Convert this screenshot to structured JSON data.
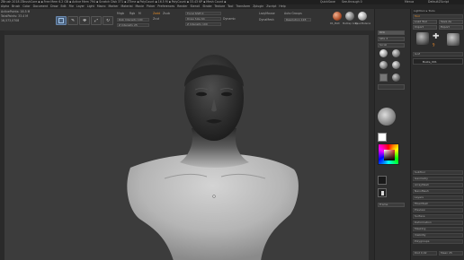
{
  "titlebar": {
    "left": "ZBrush 2018   ZBrushCore ▪  ▪ Free Mem 6.2 GB ▪ Active Mem 794 ▪ Scratch Disk 371 ▪ ZTime ▪ PolyCount ▪ 16.5 M ▪ PolyCount ▪ 33.43 KP ▪ Mesh Count ▪",
    "quicksave": "QuickSave",
    "see_through": "See-through 0",
    "menus": "Menus",
    "default_zscript": "DefaultZScript"
  },
  "menubar": {
    "items": [
      "Alpha",
      "Brush",
      "Color",
      "Document",
      "Draw",
      "Edit",
      "File",
      "Layer",
      "Light",
      "Macro",
      "Marker",
      "Material",
      "Movie",
      "Picker",
      "Preferences",
      "Render",
      "Stencil",
      "Stroke",
      "Texture",
      "Tool",
      "Transform",
      "Zplugin",
      "Zscript",
      "Help"
    ]
  },
  "toolbar": {
    "info1": "ActivePoints: 16.5 M",
    "info2": "TotalPoints: 33.4 M",
    "info3": "16,573,0708",
    "brush_labels": [
      "Edit",
      "Draw",
      "Move",
      "Scale",
      "Rotate"
    ],
    "mrgb": "Mrgb",
    "rgb": "Rgb",
    "m": "M",
    "zadd": "Zadd",
    "zsub": "Zsub",
    "zcut": "Zcut",
    "focal": "Focal Shift 0",
    "draw_size": "Draw Size 64",
    "dynamic": "Dynamic",
    "rgb_intensity": "Rgb Intensity 100",
    "z_intensity": "Z Intensity 25",
    "active_points": "Z Intensity 100",
    "lazy_mouse": "LazyMouse",
    "auto_groups": "Auto Groups",
    "dynamesh": "DynaMesh",
    "resolution": "Resolution 128",
    "material_labels": [
      "RS_Matt",
      "MatCap Gray",
      "BasicMaterial"
    ]
  },
  "shelf": {
    "buttons": [
      "BPR",
      "SPix 3",
      "Scroll",
      "Zoom",
      "Actual",
      "AAHalf",
      "Persp",
      "Floor",
      "Local",
      "LSym",
      "Xyz",
      "Frame",
      "Move",
      "Scale",
      "Rotate",
      "Line Fill",
      "PolyF",
      "Transp",
      "Ghost",
      "Solo",
      "Xpose"
    ]
  },
  "panel": {
    "header": "Lightbox ▸ Tools",
    "tool_title": "Tool",
    "load": "Load Tool",
    "save": "Save As",
    "copy": "Copy Tool",
    "paste": "Paste Tool",
    "import": "Import",
    "export": "Export",
    "clone": "Clone",
    "make_polymesh": "Make PolyMesh3D",
    "goz": "GoZ",
    "all": "All",
    "visible": "Visible",
    "r": "R",
    "current": "Buste_001",
    "rows": [
      "SubTool",
      "Geometry",
      "ArrayMesh",
      "NanoMesh",
      "Layers",
      "FiberMesh",
      "Preview",
      "Surface",
      "Deformation",
      "Masking",
      "Visibility",
      "Polygroups",
      "Contact",
      "Morph Target",
      "Polypaint",
      "UV Map",
      "Texture Map",
      "Displacement Map",
      "Normal Map"
    ],
    "list_title": "Buste_001",
    "bottom": [
      "Split",
      "Merge",
      "Remesh",
      "Project",
      "Extract",
      "Dist 0.02",
      "Mean 25"
    ]
  }
}
